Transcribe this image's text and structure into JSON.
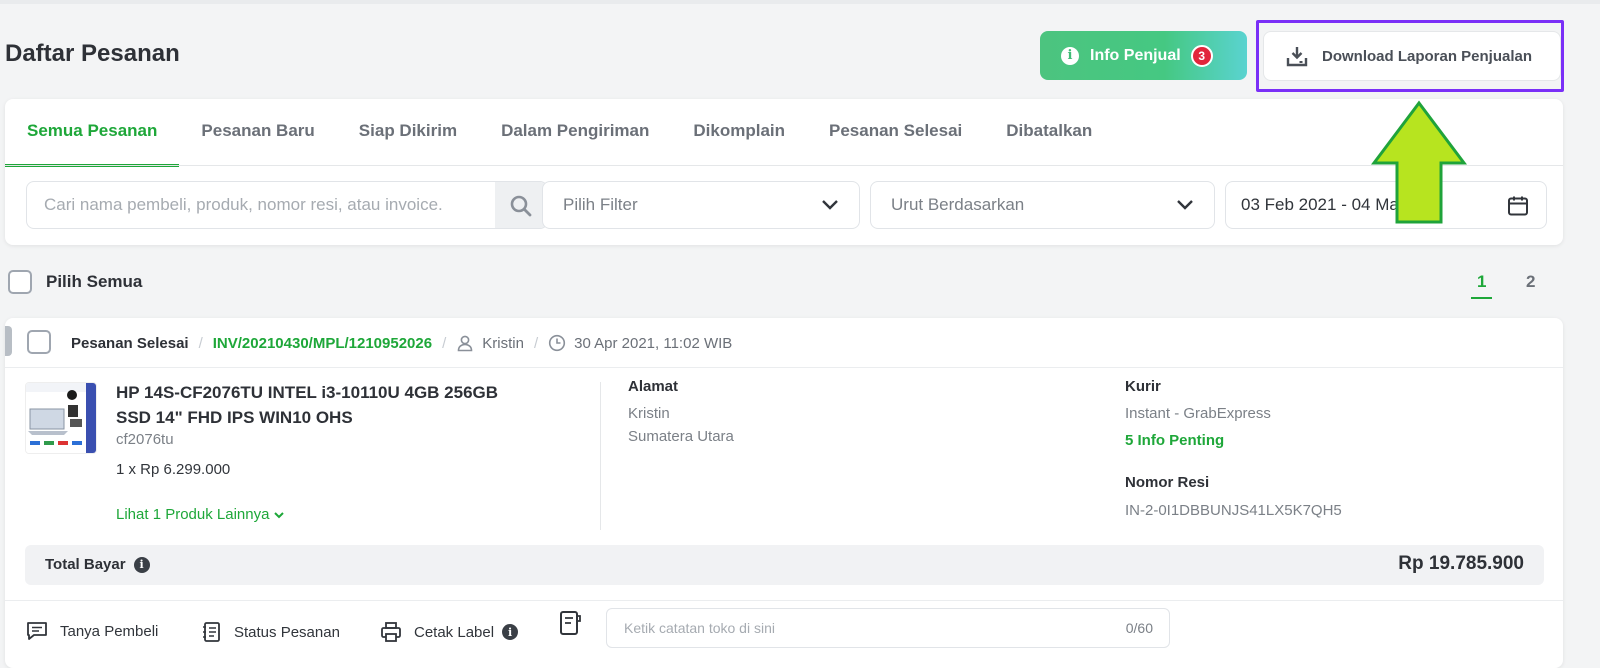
{
  "header": {
    "title": "Daftar Pesanan",
    "info_button": {
      "label": "Info Penjual",
      "badge": "3"
    },
    "download_button": {
      "label": "Download Laporan Penjualan"
    }
  },
  "tabs": [
    {
      "label": "Semua Pesanan",
      "active": true
    },
    {
      "label": "Pesanan Baru",
      "active": false
    },
    {
      "label": "Siap Dikirim",
      "active": false
    },
    {
      "label": "Dalam Pengiriman",
      "active": false
    },
    {
      "label": "Dikomplain",
      "active": false
    },
    {
      "label": "Pesanan Selesai",
      "active": false
    },
    {
      "label": "Dibatalkan",
      "active": false
    }
  ],
  "filters": {
    "search_placeholder": "Cari nama pembeli, produk, nomor resi, atau invoice.",
    "filter_label": "Pilih Filter",
    "sort_label": "Urut Berdasarkan",
    "date_range": "03 Feb 2021 - 04 Ma      1"
  },
  "list": {
    "select_all_label": "Pilih Semua",
    "pages": [
      "1",
      "2"
    ],
    "current_page": "1"
  },
  "order": {
    "status": "Pesanan Selesai",
    "invoice": "INV/20210430/MPL/1210952026",
    "buyer": "Kristin",
    "datetime": "30 Apr 2021, 11:02 WIB",
    "product": {
      "name": "HP 14S-CF2076TU INTEL i3-10110U 4GB 256GB SSD 14\" FHD IPS WIN10 OHS",
      "sku": "cf2076tu",
      "qty_price": "1 x Rp 6.299.000",
      "more_link": "Lihat 1 Produk Lainnya"
    },
    "address": {
      "label": "Alamat",
      "name": "Kristin",
      "region": "Sumatera Utara"
    },
    "courier": {
      "label": "Kurir",
      "service": "Instant - GrabExpress",
      "info_link": "5 Info Penting",
      "resi_label": "Nomor Resi",
      "resi": "IN-2-0I1DBBUNJS41LX5K7QH5"
    },
    "total": {
      "label": "Total Bayar",
      "value": "Rp 19.785.900"
    },
    "actions": {
      "ask_buyer": "Tanya Pembeli",
      "order_status": "Status Pesanan",
      "print_label": "Cetak Label",
      "note_placeholder": "Ketik catatan toko di sini",
      "note_count": "0/60"
    }
  },
  "colors": {
    "accent_green": "#1ea739",
    "highlight_purple": "#7a2ff7",
    "arrow_green": "#b7e41f",
    "badge_red": "#e1253c"
  }
}
